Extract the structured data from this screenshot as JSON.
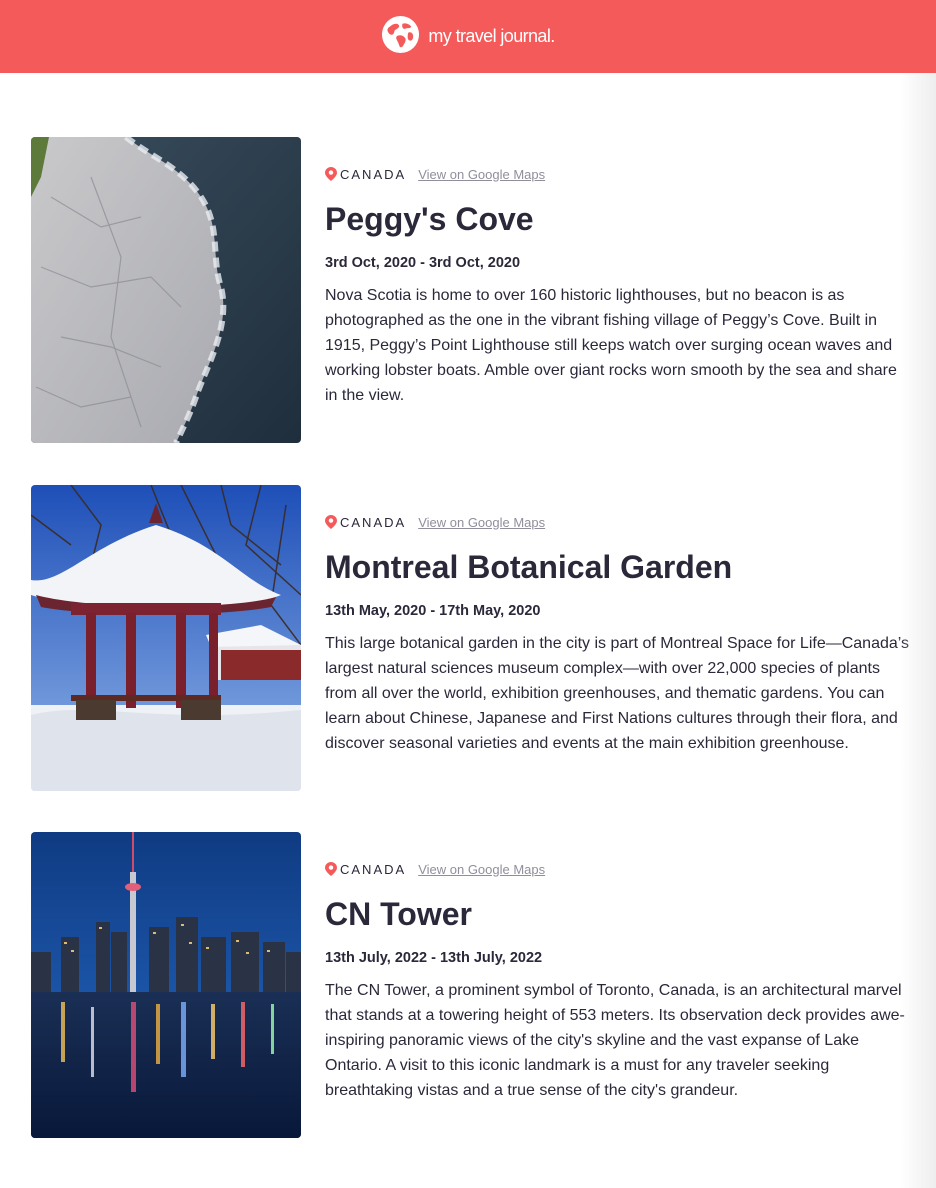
{
  "header": {
    "logo_icon": "globe-icon",
    "title": "my travel journal."
  },
  "colors": {
    "brand": "#f55a5a",
    "text": "#2b283a",
    "muted_link": "#918e9b"
  },
  "entries": [
    {
      "image": "rocky-coastline-aerial-photo",
      "pin_icon": "location-pin-icon",
      "country": "CANADA",
      "maps_label": "View on Google Maps",
      "title": "Peggy's Cove",
      "dates": "3rd Oct, 2020 - 3rd Oct, 2020",
      "description": "Nova Scotia is home to over 160 historic lighthouses, but no beacon is as photographed as the one in the vibrant fishing village of Peggy’s Cove. Built in 1915, Peggy’s Point Lighthouse still keeps watch over surging ocean waves and working lobster boats. Amble over giant rocks worn smooth by the sea and share in the view."
    },
    {
      "image": "chinese-pavilion-in-snow-photo",
      "pin_icon": "location-pin-icon",
      "country": "CANADA",
      "maps_label": "View on Google Maps",
      "title": "Montreal Botanical Garden",
      "dates": "13th May, 2020 - 17th May, 2020",
      "description": "This large botanical garden in the city is part of Montreal Space for Life—Canada’s largest natural sciences museum complex—with over 22,000 species of plants from all over the world, exhibition greenhouses, and thematic gardens. You can learn about Chinese, Japanese and First Nations cultures through their flora, and discover seasonal varieties and events at the main exhibition greenhouse."
    },
    {
      "image": "toronto-skyline-night-photo",
      "pin_icon": "location-pin-icon",
      "country": "CANADA",
      "maps_label": "View on Google Maps",
      "title": "CN Tower",
      "dates": "13th July, 2022 - 13th July, 2022",
      "description": "The CN Tower, a prominent symbol of Toronto, Canada, is an architectural marvel that stands at a towering height of 553 meters. Its observation deck provides awe-inspiring panoramic views of the city's skyline and the vast expanse of Lake Ontario. A visit to this iconic landmark is a must for any traveler seeking breathtaking vistas and a true sense of the city's grandeur."
    }
  ]
}
